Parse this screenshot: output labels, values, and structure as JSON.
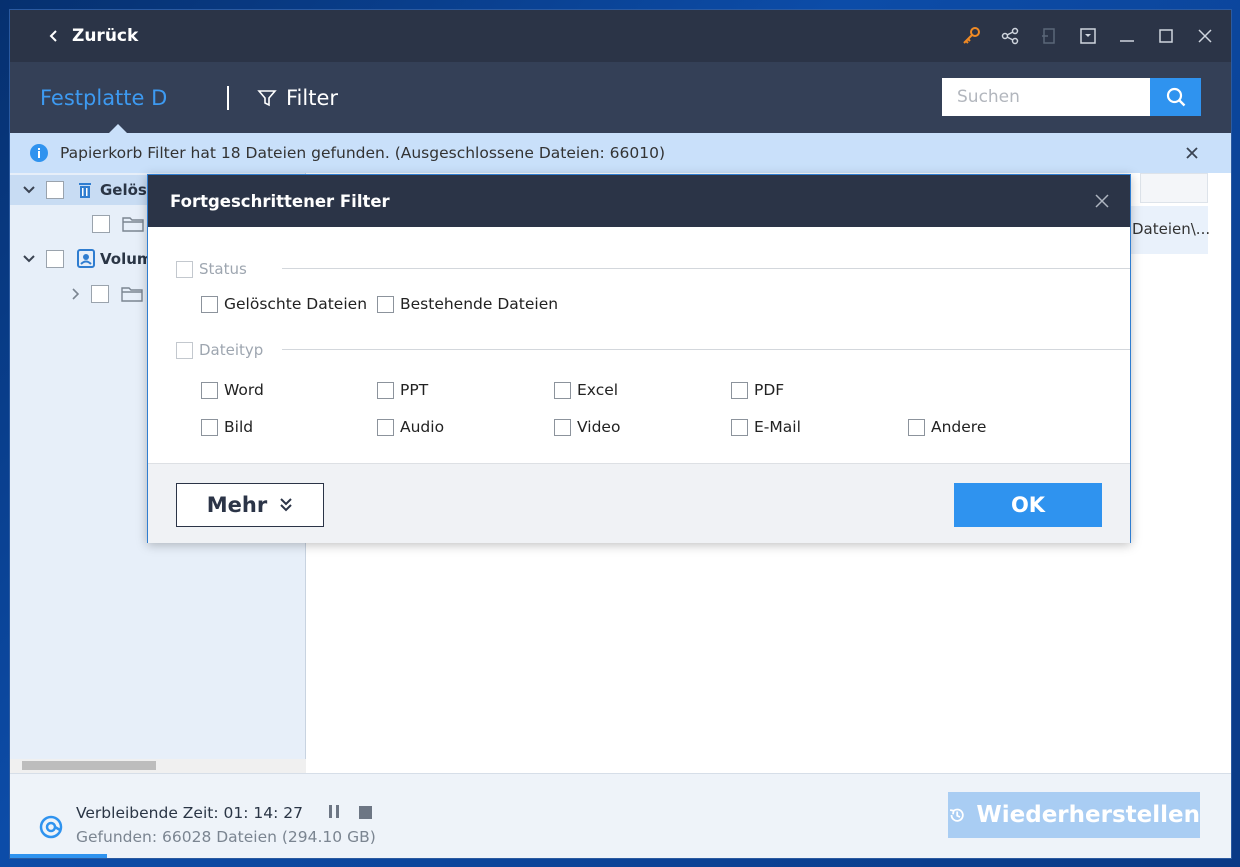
{
  "titlebar": {
    "back_label": "Zurück"
  },
  "header": {
    "drive_title": "Festplatte D",
    "filter_label": "Filter",
    "search_placeholder": "Suchen"
  },
  "infobar": {
    "message": "Papierkorb Filter hat 18 Dateien gefunden. (Ausgeschlossene Dateien: 66010)"
  },
  "tree": {
    "items": [
      {
        "label": "Gelös"
      },
      {
        "label": "Volum"
      }
    ]
  },
  "content": {
    "path_text": "Dateien\\..."
  },
  "status": {
    "remaining": "Verbleibende Zeit: 01: 14: 27",
    "found": "Gefunden: 66028 Dateien (294.10 GB)",
    "restore_label": "Wiederherstellen"
  },
  "modal": {
    "title": "Fortgeschrittener Filter",
    "status_section": "Status",
    "status_options": [
      "Gelöschte Dateien",
      "Bestehende Dateien"
    ],
    "filetype_section": "Dateityp",
    "filetype_options": [
      "Word",
      "PPT",
      "Excel",
      "PDF",
      "Bild",
      "Audio",
      "Video",
      "E-Mail",
      "Andere"
    ],
    "more_label": "Mehr",
    "ok_label": "OK"
  },
  "colors": {
    "accent": "#2f93ef",
    "titlebar": "#2b3447",
    "header": "#344057",
    "info": "#c9e0fa",
    "key_icon": "#f08a24"
  },
  "icons": [
    "chevron-left-icon",
    "key-icon",
    "share-icon",
    "export-icon",
    "dropdown-icon",
    "minimize-icon",
    "maximize-icon",
    "close-icon",
    "filter-icon",
    "search-icon",
    "info-icon",
    "trash-icon",
    "drive-icon",
    "folder-icon",
    "scan-icon",
    "pause-icon",
    "stop-icon",
    "restore-icon",
    "double-chevron-down-icon"
  ]
}
